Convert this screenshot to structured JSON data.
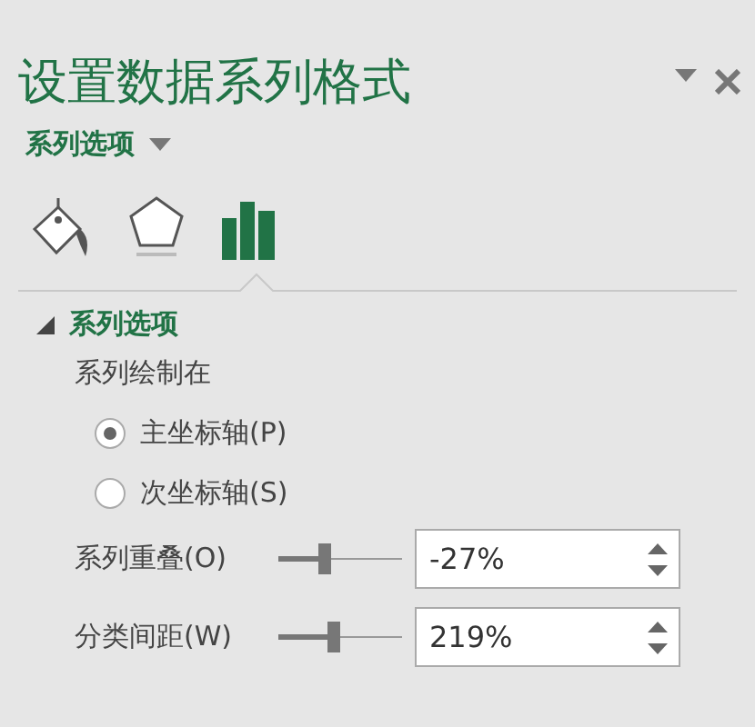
{
  "pane": {
    "title": "设置数据系列格式",
    "subtitle": "系列选项"
  },
  "tabs": [
    {
      "kind": "fill",
      "selected": false
    },
    {
      "kind": "effects",
      "selected": false
    },
    {
      "kind": "series",
      "selected": true
    }
  ],
  "section": {
    "title": "系列选项",
    "expanded": true,
    "plot_on_label": "系列绘制在",
    "radios": [
      {
        "label": "主坐标轴(P)",
        "selected": true
      },
      {
        "label": "次坐标轴(S)",
        "selected": false
      }
    ],
    "sliders": [
      {
        "label": "系列重叠(O)",
        "level": 0.37,
        "value": "-27%"
      },
      {
        "label": "分类间距(W)",
        "level": 0.44,
        "value": "219%"
      }
    ]
  }
}
